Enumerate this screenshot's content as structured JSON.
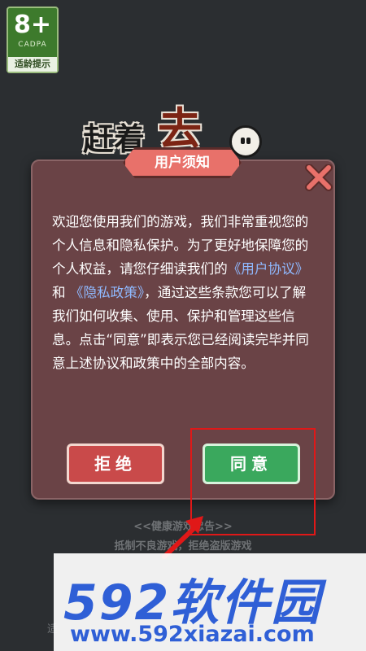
{
  "age_badge": {
    "rating": "8+",
    "org": "CADPA",
    "tip": "适龄提示"
  },
  "logo": {
    "text_black": "赶着",
    "text_red": "去"
  },
  "dialog": {
    "title": "用户须知",
    "body_before": "欢迎您使用我们的游戏，我们非常重视您的个人信息和隐私保护。为了更好地保障您的个人权益，请您仔细读我们的",
    "link_user_agreement": "《用户协议》",
    "body_and": "和",
    "link_privacy_policy": "《隐私政策》",
    "body_after": "，通过这些条款您可以了解我们如何收集、使用、保护和管理这些信息。点击“同意”即表示您已经阅读完毕并同意上述协议和政策中的全部内容。",
    "reject_label": "拒绝",
    "agree_label": "同意"
  },
  "health_notice": {
    "line1": "<<健康游戏忠告>>",
    "line2": "抵制不良游戏，拒绝盗版游戏",
    "line3_fragment": "适"
  },
  "watermark": {
    "brand": "592软件园",
    "url": "www.592xiazai.com"
  },
  "colors": {
    "agree": "#3aa85d",
    "reject": "#c94a4a",
    "link": "#8fb9ff",
    "annotation": "#e01818"
  }
}
